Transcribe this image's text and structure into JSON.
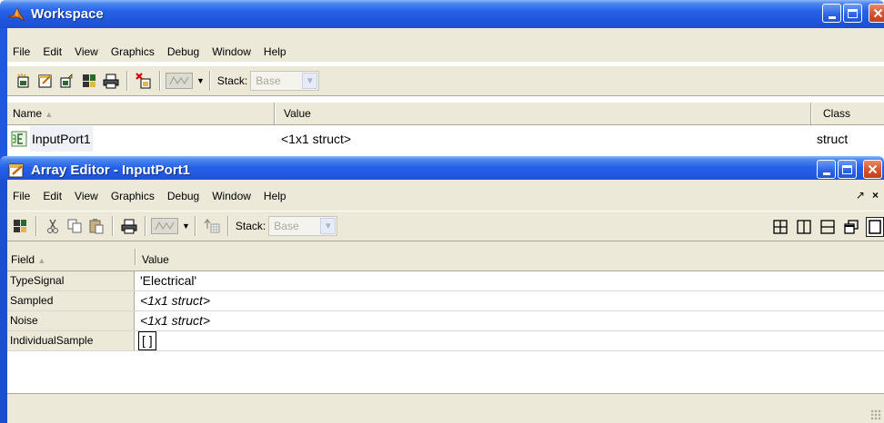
{
  "workspace": {
    "title": "Workspace",
    "menu": [
      "File",
      "Edit",
      "View",
      "Graphics",
      "Debug",
      "Window",
      "Help"
    ],
    "toolbar": {
      "stack_label": "Stack:",
      "stack_value": "Base"
    },
    "columns": {
      "name": "Name",
      "value": "Value",
      "class": "Class"
    },
    "rows": [
      {
        "name": "InputPort1",
        "value": "<1x1 struct>",
        "class": "struct"
      }
    ]
  },
  "array_editor": {
    "title": "Array Editor - InputPort1",
    "menu": [
      "File",
      "Edit",
      "View",
      "Graphics",
      "Debug",
      "Window",
      "Help"
    ],
    "undock_glyph": "↗",
    "close_glyph": "×",
    "toolbar": {
      "stack_label": "Stack:",
      "stack_value": "Base"
    },
    "columns": {
      "field": "Field",
      "value": "Value"
    },
    "rows": [
      {
        "field": "TypeSignal",
        "value": "'Electrical'"
      },
      {
        "field": "Sampled",
        "value": "<1x1 struct>"
      },
      {
        "field": "Noise",
        "value": "<1x1 struct>"
      },
      {
        "field": "IndividualSample",
        "value": "[ ]"
      }
    ]
  },
  "colors": {
    "titlebar_blue": "#1f58de",
    "chrome_beige": "#ece9d8",
    "close_red": "#d9502b"
  }
}
